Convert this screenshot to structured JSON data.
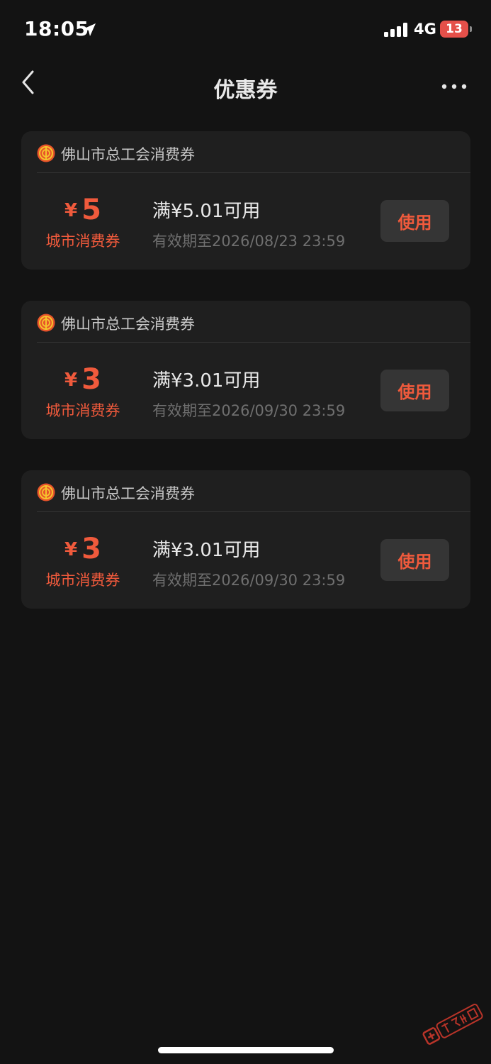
{
  "status_bar": {
    "time": "18:05",
    "network": "4G",
    "battery_level": "13"
  },
  "nav": {
    "title": "优惠券"
  },
  "coupons": [
    {
      "issuer": "佛山市总工会消费券",
      "currency": "¥",
      "amount": "5",
      "type": "城市消费券",
      "condition": "满¥5.01可用",
      "validity": "有效期至2026/08/23 23:59",
      "button_label": "使用"
    },
    {
      "issuer": "佛山市总工会消费券",
      "currency": "¥",
      "amount": "3",
      "type": "城市消费券",
      "condition": "满¥3.01可用",
      "validity": "有效期至2026/09/30 23:59",
      "button_label": "使用"
    },
    {
      "issuer": "佛山市总工会消费券",
      "currency": "¥",
      "amount": "3",
      "type": "城市消费券",
      "condition": "满¥3.01可用",
      "validity": "有效期至2026/09/30 23:59",
      "button_label": "使用"
    }
  ],
  "watermark": {
    "text": "卡农社区"
  },
  "colors": {
    "background": "#131313",
    "card": "#1f1f1f",
    "accent": "#f05a3c",
    "button": "#353535"
  }
}
